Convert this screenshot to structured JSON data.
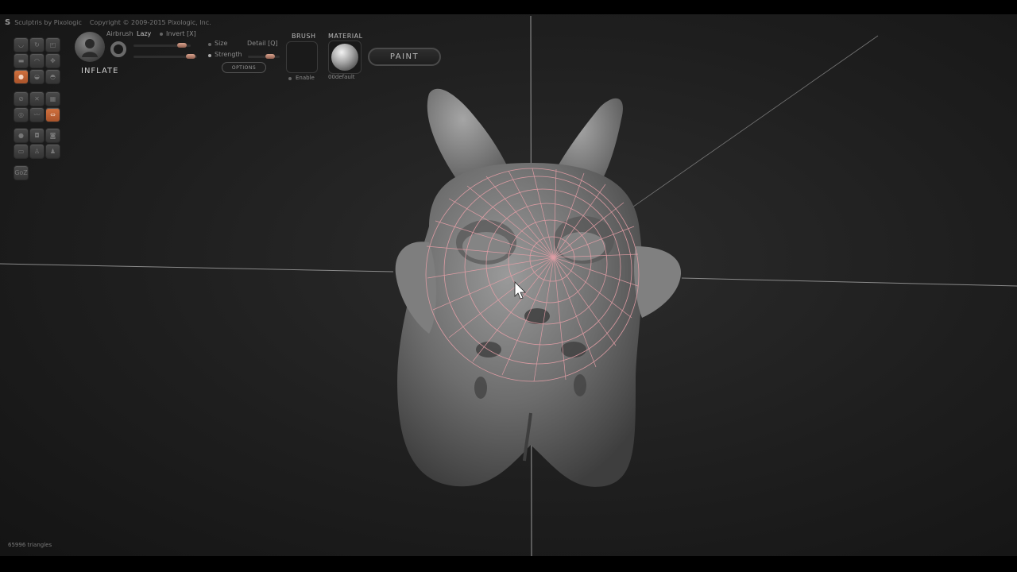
{
  "window": {
    "app_title": "Sculptris by Pixologic",
    "copyright": "Copyright © 2009-2015 Pixologic, Inc."
  },
  "brush": {
    "name": "INFLATE",
    "airbrush_label": "Airbrush",
    "lazy_label": "Lazy",
    "invert_label": "Invert [X]",
    "size_label": "Size",
    "strength_label": "Strength",
    "detail_label": "Detail [Q]",
    "options_label": "OPTIONS",
    "size_value": 0.85,
    "strength_value": 0.9,
    "detail_value": 0.7
  },
  "texture": {
    "brush_heading": "BRUSH",
    "material_heading": "MATERIAL",
    "enable_label": "Enable",
    "material_name": "00default"
  },
  "paint_button_label": "PAINT",
  "palette": {
    "goz_label": "GoZ"
  },
  "status": {
    "triangles": "65996 triangles"
  },
  "colors": {
    "accent": "#c9643a",
    "cursor_ring": "#e8a0a8"
  }
}
